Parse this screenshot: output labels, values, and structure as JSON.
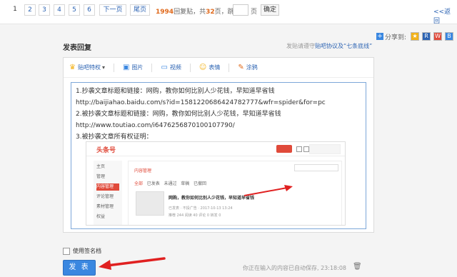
{
  "pager": {
    "pages": [
      "1",
      "2",
      "3",
      "4",
      "5",
      "6"
    ],
    "current": "1",
    "next": "下一页",
    "last": "尾页",
    "replies": "1994",
    "replies_suffix": "回复贴，共",
    "total_pages": "32",
    "total_suffix": "页，跳到",
    "page_unit": "页",
    "confirm": "确定",
    "back": "<<返回"
  },
  "share": {
    "label": "分享到:",
    "icons": [
      "qzone-icon",
      "renren-icon",
      "weibo-icon",
      "baidu-icon"
    ]
  },
  "reply": {
    "title": "发表回复",
    "agree_prefix": "发贴请遵守",
    "agree_link": "贴吧协议及“七条底线”"
  },
  "toolbar": {
    "privilege": "贴吧特权",
    "image": "图片",
    "video": "视频",
    "emoji": "表情",
    "doodle": "涂鸦"
  },
  "content": {
    "lines": [
      "1.抄袭文章标题和链接：网购，教你如何比别人少花钱，早知道早省钱",
      "http://baijiahao.baidu.com/s?id=1581220686424782777&wfr=spider&for=pc",
      "2.被抄袭文章标题和链接：网购，教你如何比别人少花钱，早知道早省钱",
      "http://www.toutiao.com/i6476256870100107790/",
      "3.被抄袭文章所有权证明："
    ]
  },
  "screenshot": {
    "logo": "头条号",
    "sidebar": [
      "主页",
      "管理",
      "内容管理",
      "评论管理",
      "素材管理",
      "权益"
    ],
    "panel_title": "内容管理",
    "tabs": [
      "全部",
      "已发表",
      "未通过",
      "草稿",
      "已撤回"
    ],
    "article_title": "网购，教你如何比别人少花钱，早知道早省钱",
    "meta1": "已发表 · 不投广告 · 2017-10-13 13:24",
    "meta2": "推荐 244   阅读 40   评论 0   转发 0"
  },
  "footer": {
    "signature": "使用签名档",
    "submit": "发 表",
    "autosave": "你正在输入的内容已自动保存, 23:18:08"
  }
}
